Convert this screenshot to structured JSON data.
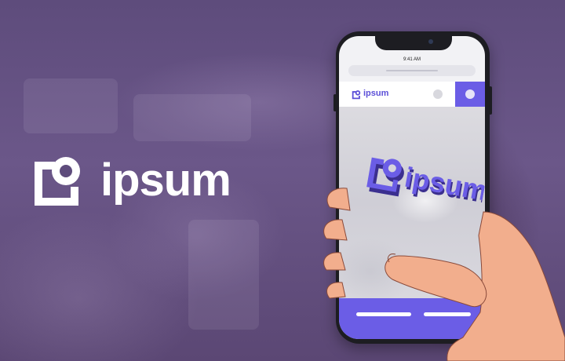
{
  "brand": {
    "name": "ipsum",
    "logo_icon": "ipsum-logo-icon",
    "color_primary": "#6b5de6",
    "color_logo_text": "#5b4fd8"
  },
  "phone": {
    "status_time": "9:41 AM",
    "nav_logo_text": "ipsum",
    "content_logo_text": "ipsum"
  },
  "colors": {
    "background": "#5e4c7c",
    "skin": "#f2ae8d",
    "phone_frame": "#1d1d22"
  }
}
